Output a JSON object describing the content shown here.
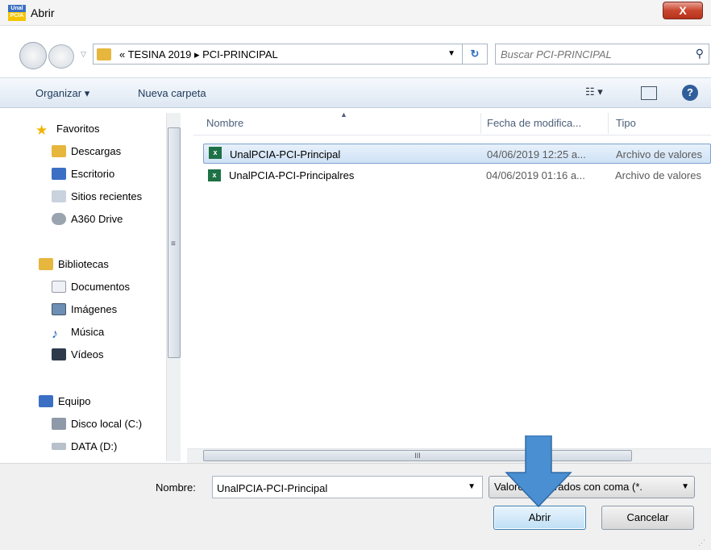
{
  "window": {
    "title": "Abrir",
    "close_label": "X",
    "app_icon_text": "Unal PCIA"
  },
  "address": {
    "breadcrumb": "«  TESINA 2019  ▸  PCI-PRINCIPAL",
    "search_placeholder": "Buscar PCI-PRINCIPAL"
  },
  "toolbar": {
    "organize": "Organizar ▾",
    "new_folder": "Nueva carpeta",
    "view_icon": "view-menu-icon"
  },
  "nav": {
    "favorites": "Favoritos",
    "fav_items": [
      "Descargas",
      "Escritorio",
      "Sitios recientes",
      "A360 Drive"
    ],
    "libraries": "Bibliotecas",
    "lib_items": [
      "Documentos",
      "Imágenes",
      "Música",
      "Vídeos"
    ],
    "computer": "Equipo",
    "drives": [
      "Disco local (C:)",
      "DATA (D:)"
    ]
  },
  "columns": {
    "name": "Nombre",
    "date": "Fecha de modifica...",
    "type": "Tipo"
  },
  "files": [
    {
      "name": "UnalPCIA-PCI-Principal",
      "date": "04/06/2019 12:25 a...",
      "type": "Archivo de valores"
    },
    {
      "name": "UnalPCIA-PCI-Principalres",
      "date": "04/06/2019 01:16 a...",
      "type": "Archivo de valores"
    }
  ],
  "bottom": {
    "filename_label": "Nombre:",
    "filename_value": "UnalPCIA-PCI-Principal",
    "filetype": "Valores separados con coma (*.",
    "open_label": "Abrir",
    "cancel_label": "Cancelar"
  },
  "colors": {
    "selection": "#cfe2f6",
    "arrow": "#4a8fd1",
    "excel": "#1e7145"
  }
}
